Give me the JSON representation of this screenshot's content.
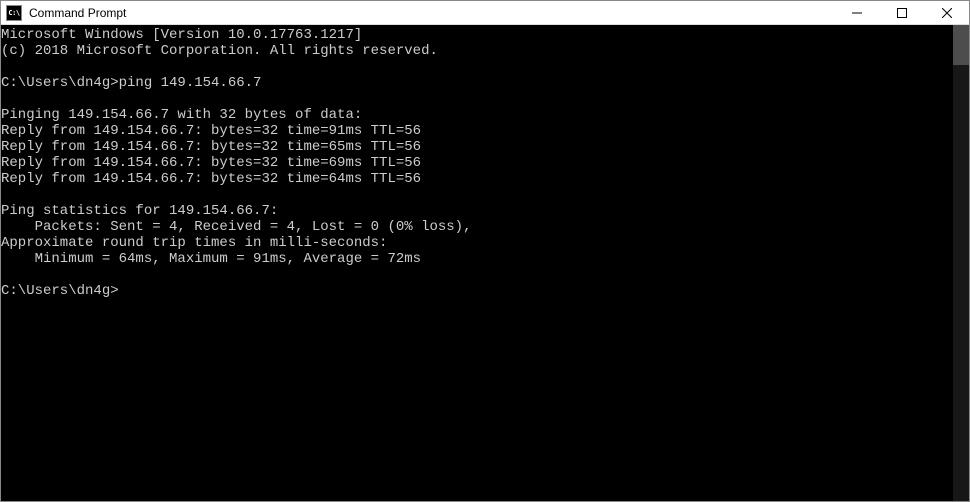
{
  "titlebar": {
    "icon_text": "C:\\",
    "title": "Command Prompt"
  },
  "terminal": {
    "lines": [
      "Microsoft Windows [Version 10.0.17763.1217]",
      "(c) 2018 Microsoft Corporation. All rights reserved.",
      "",
      "C:\\Users\\dn4g>ping 149.154.66.7",
      "",
      "Pinging 149.154.66.7 with 32 bytes of data:",
      "Reply from 149.154.66.7: bytes=32 time=91ms TTL=56",
      "Reply from 149.154.66.7: bytes=32 time=65ms TTL=56",
      "Reply from 149.154.66.7: bytes=32 time=69ms TTL=56",
      "Reply from 149.154.66.7: bytes=32 time=64ms TTL=56",
      "",
      "Ping statistics for 149.154.66.7:",
      "    Packets: Sent = 4, Received = 4, Lost = 0 (0% loss),",
      "Approximate round trip times in milli-seconds:",
      "    Minimum = 64ms, Maximum = 91ms, Average = 72ms",
      "",
      "C:\\Users\\dn4g>"
    ]
  }
}
